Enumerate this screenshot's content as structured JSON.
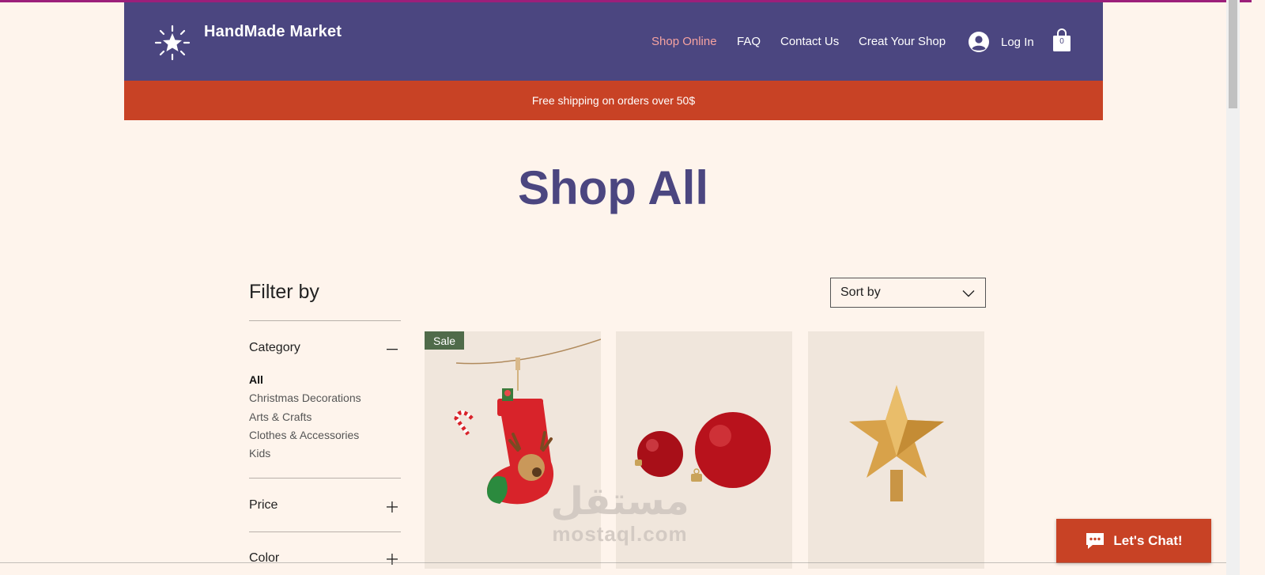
{
  "header": {
    "brand": "HandMade Market",
    "nav": [
      {
        "label": "Shop Online",
        "active": true
      },
      {
        "label": "FAQ",
        "active": false
      },
      {
        "label": "Contact Us",
        "active": false
      },
      {
        "label": "Creat Your Shop",
        "active": false
      }
    ],
    "login_label": "Log In",
    "cart_count": "0"
  },
  "promo": {
    "text": "Free shipping on orders over 50$"
  },
  "page": {
    "title": "Shop All"
  },
  "filters": {
    "title": "Filter by",
    "sections": [
      {
        "label": "Category",
        "expanded": true
      },
      {
        "label": "Price",
        "expanded": false
      },
      {
        "label": "Color",
        "expanded": false
      }
    ],
    "categories": [
      "All",
      "Christmas Decorations",
      "Arts & Crafts",
      "Clothes & Accessories",
      "Kids"
    ],
    "selected_category": "All"
  },
  "sort": {
    "label": "Sort by"
  },
  "products": [
    {
      "image": "christmas-stocking",
      "badge": "Sale"
    },
    {
      "image": "red-ornament-balls",
      "badge": ""
    },
    {
      "image": "gold-star-topper",
      "badge": ""
    }
  ],
  "watermark": {
    "arabic": "مستقل",
    "latin": "mostaql.com"
  },
  "chat": {
    "label": "Let's Chat!"
  },
  "colors": {
    "header_bg": "#4b4680",
    "promo_bg": "#c84225",
    "page_bg": "#fef4ec",
    "title": "#4b4680",
    "nav_active": "#f6a3a0",
    "sale_badge": "#4f6b4a",
    "chat_bg": "#c84225"
  }
}
